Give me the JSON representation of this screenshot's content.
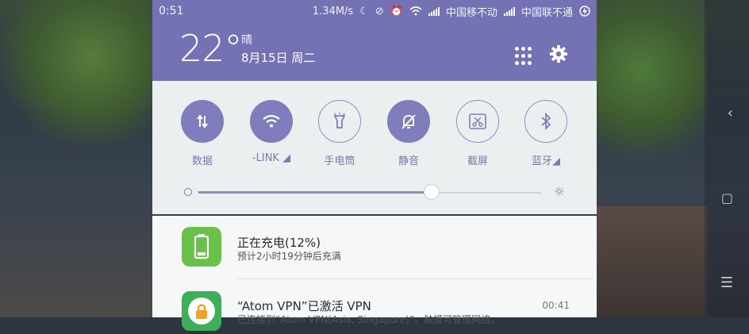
{
  "status_bar": {
    "time": "0:51",
    "speed": "1.34M/s",
    "carrier1": "中国移不动",
    "carrier2": "中国联不通",
    "icons": [
      "moon-icon",
      "dnd-icon",
      "alarm-icon",
      "wifi-icon",
      "signal-icon",
      "signal-icon",
      "battery-charging-icon"
    ]
  },
  "header": {
    "temperature": "22°",
    "weather": "晴",
    "date": "8月15日 周二"
  },
  "toggles": [
    {
      "label": "数据",
      "state": "on",
      "icon": "data-arrows-icon"
    },
    {
      "label": "-LINK ◢",
      "state": "on",
      "icon": "wifi-icon"
    },
    {
      "label": "手电筒",
      "state": "off",
      "icon": "flashlight-icon"
    },
    {
      "label": "静音",
      "state": "on",
      "icon": "bell-off-icon"
    },
    {
      "label": "截屏",
      "state": "off",
      "icon": "scissors-icon"
    },
    {
      "label": "蓝牙◢",
      "state": "off",
      "icon": "bluetooth-icon"
    }
  ],
  "brightness": {
    "level": 0.68
  },
  "notifications": [
    {
      "title": "正在充电(12%)",
      "subtitle": "预计2小时19分钟后充满",
      "time": "",
      "icon": "battery-icon"
    },
    {
      "title": "“Atom VPN”已激活 VPN",
      "subtitle": "已连接到“Atom VPN(Asia, Singapore)”。触摸可管理网络。",
      "time": "00:41",
      "icon": "vpn-lock-icon"
    }
  ],
  "colors": {
    "accent": "#7472b4",
    "toggle_on": "#7f7dbc",
    "battery_green": "#6ac14a"
  }
}
